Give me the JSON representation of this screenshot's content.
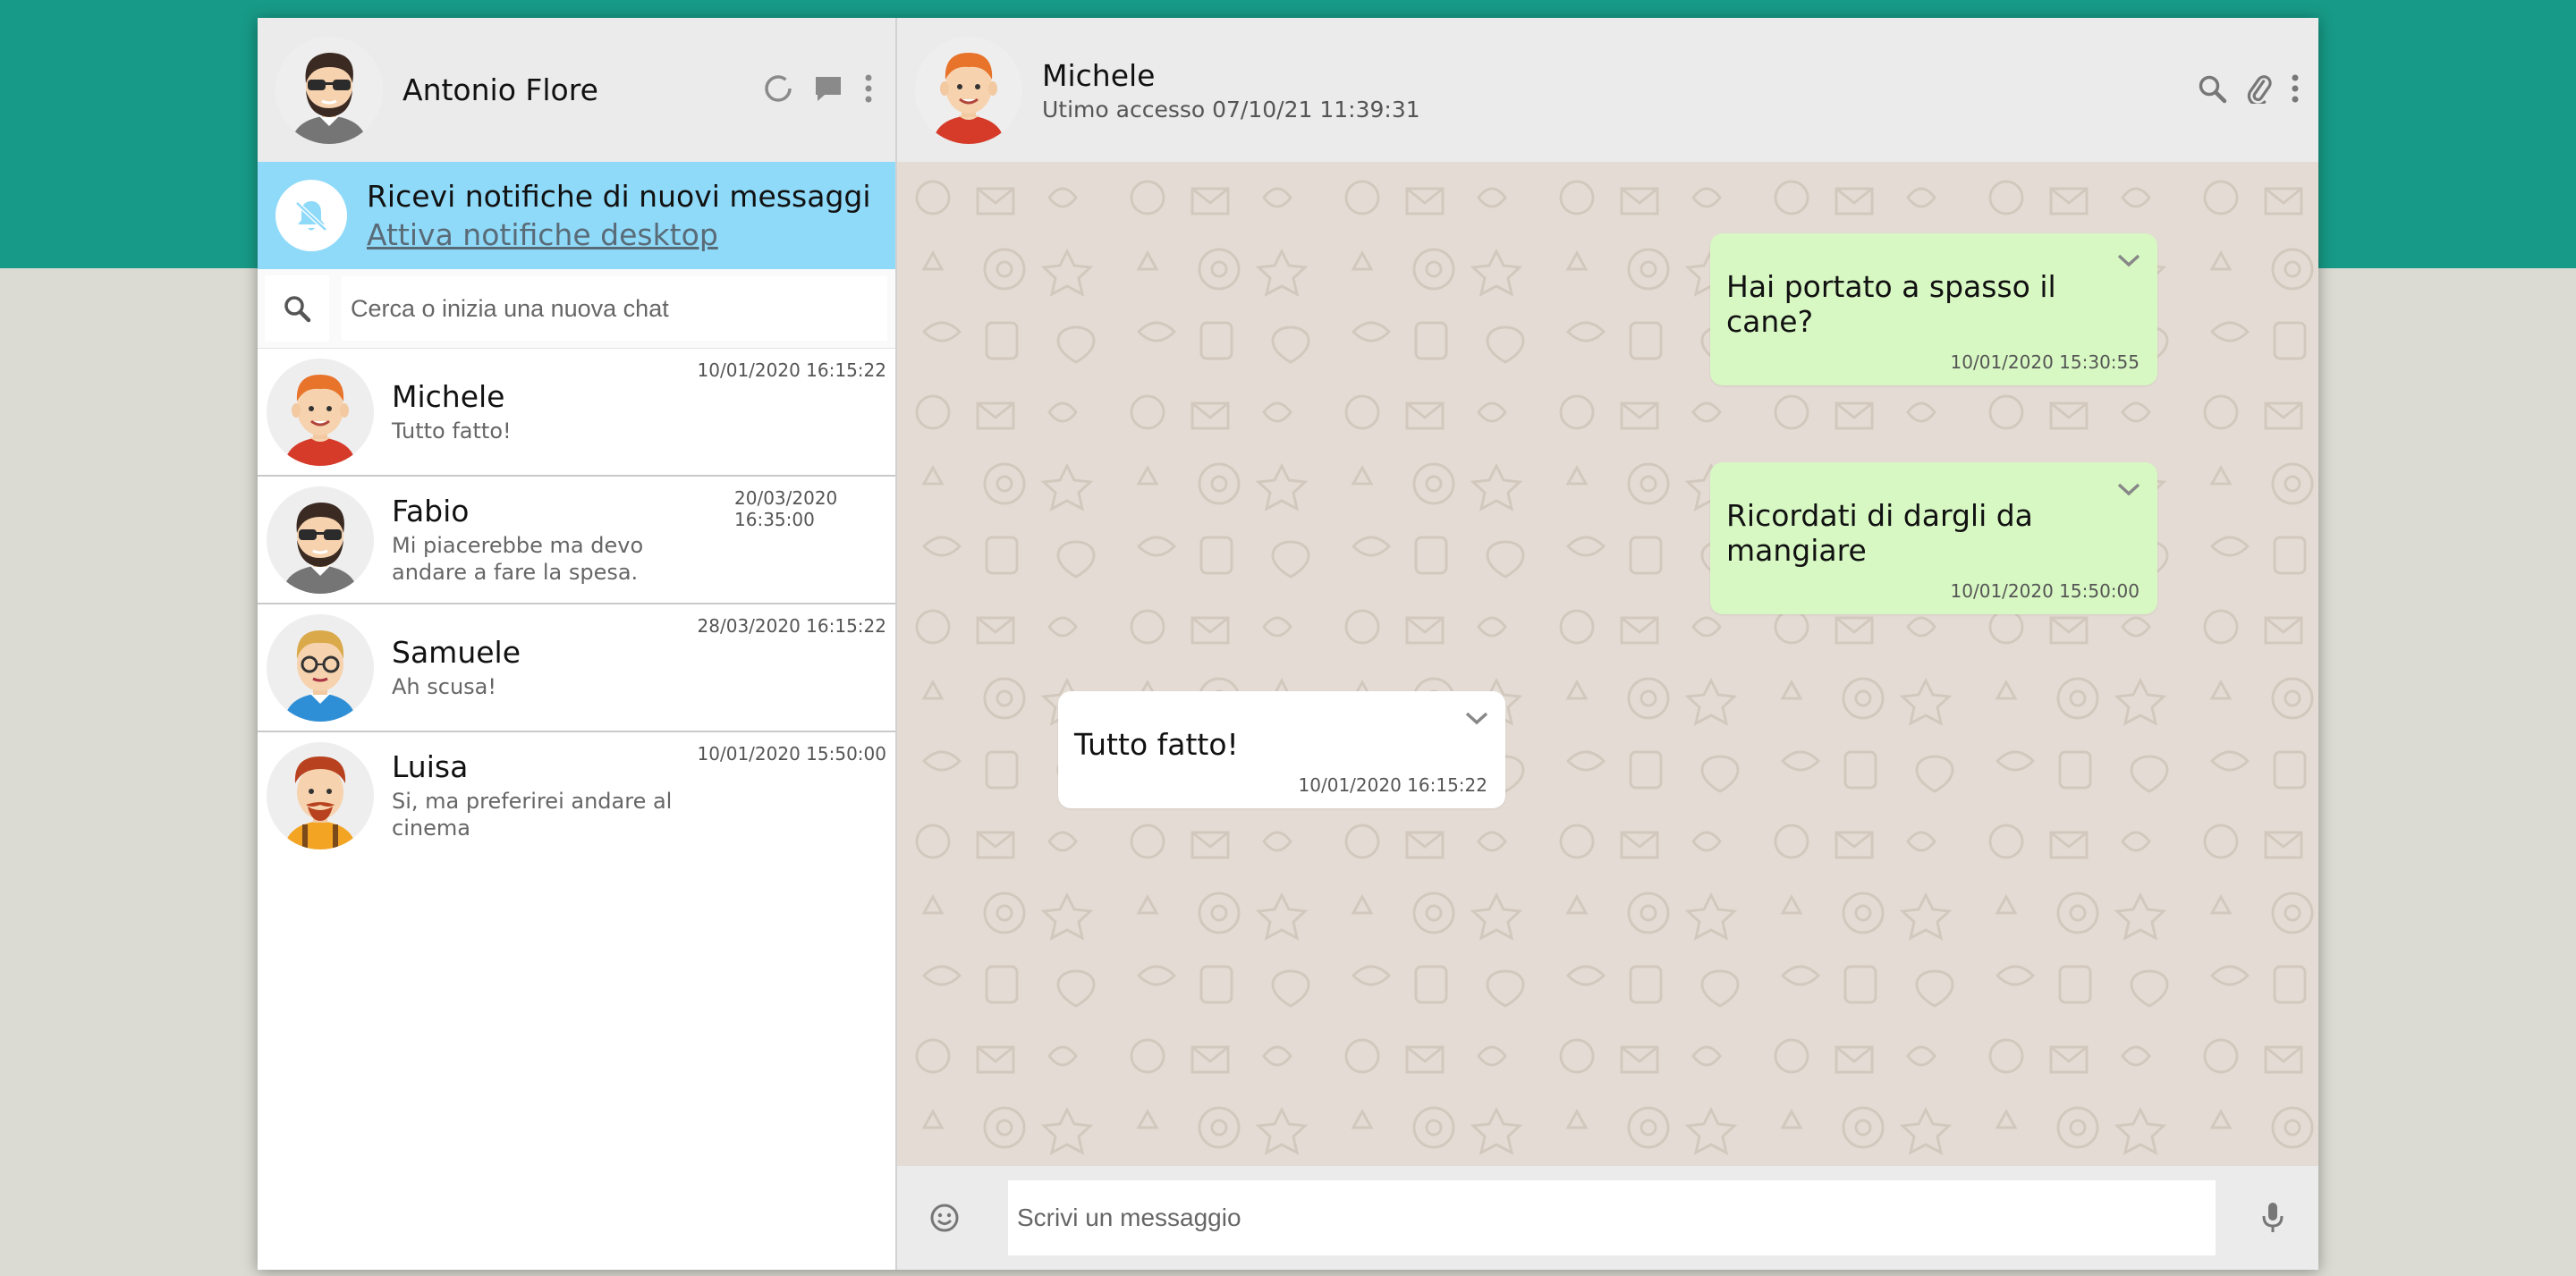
{
  "user": {
    "name": "Antonio Flore"
  },
  "notification": {
    "title": "Ricevi notifiche di nuovi messaggi",
    "link": "Attiva notifiche desktop"
  },
  "search": {
    "placeholder": "Cerca o inizia una nuova chat"
  },
  "chats": [
    {
      "name": "Michele",
      "last": "Tutto fatto!",
      "time": "10/01/2020 16:15:22"
    },
    {
      "name": "Fabio",
      "last": "Mi piacerebbe ma devo andare a fare la spesa.",
      "time": "20/03/2020 16:35:00"
    },
    {
      "name": "Samuele",
      "last": "Ah scusa!",
      "time": "28/03/2020 16:15:22"
    },
    {
      "name": "Luisa",
      "last": "Si, ma preferirei andare al cinema",
      "time": "10/01/2020 15:50:00"
    }
  ],
  "active": {
    "name": "Michele",
    "status": "Utimo accesso 07/10/21 11:39:31"
  },
  "messages": [
    {
      "type": "sent",
      "text": "Hai portato a spasso il cane?",
      "time": "10/01/2020 15:30:55"
    },
    {
      "type": "sent",
      "text": "Ricordati di dargli da mangiare",
      "time": "10/01/2020 15:50:00"
    },
    {
      "type": "received",
      "text": "Tutto fatto!",
      "time": "10/01/2020 16:15:22"
    }
  ],
  "composer": {
    "placeholder": "Scrivi un messaggio"
  },
  "icons": {
    "status": "status-ring-icon",
    "new_chat": "chat-bubble-icon",
    "menu": "vertical-dots-icon",
    "bell_off": "bell-off-icon",
    "search": "search-icon",
    "attach": "paperclip-icon",
    "emoji": "smiley-icon",
    "mic": "microphone-icon",
    "chevron": "chevron-down-icon"
  },
  "colors": {
    "top_band": "#179a87",
    "background": "#dbdbd3",
    "notification": "#8fdaf9",
    "sent_bubble": "#d7f8c3",
    "received_bubble": "#ffffff",
    "chat_background": "#e4dcd4"
  }
}
